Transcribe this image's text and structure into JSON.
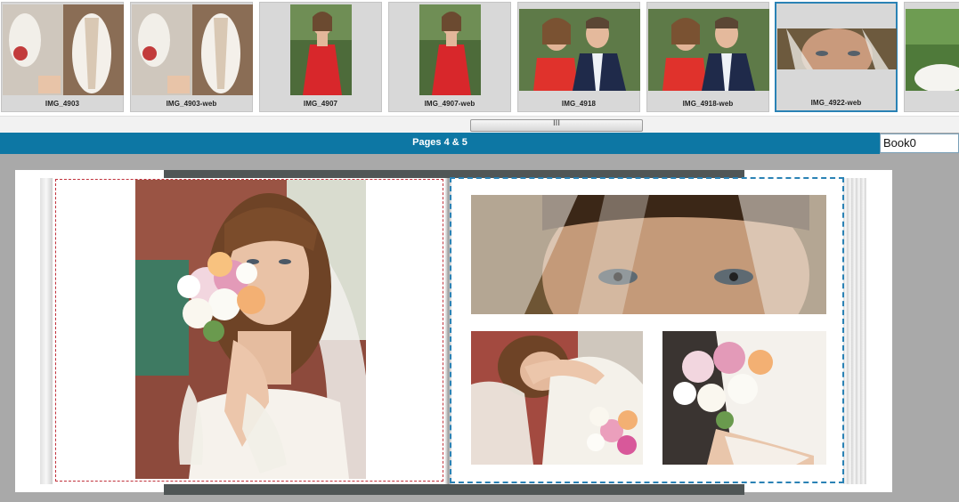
{
  "filmstrip": {
    "thumbnails": [
      {
        "caption": "IMG_4903"
      },
      {
        "caption": "IMG_4903-web"
      },
      {
        "caption": "IMG_4907"
      },
      {
        "caption": "IMG_4907-web"
      },
      {
        "caption": "IMG_4918"
      },
      {
        "caption": "IMG_4918-web"
      },
      {
        "caption": "IMG_4922-web",
        "selected": true
      },
      {
        "caption": ""
      }
    ],
    "scroll_grip": "III"
  },
  "editor": {
    "title": "Pages 4 & 5",
    "book_field_value": "Book0"
  },
  "colors": {
    "accent": "#0d77a4",
    "selection": "#2a82b5",
    "left_frame": "#c0303a",
    "background": "#a9a9a9"
  }
}
